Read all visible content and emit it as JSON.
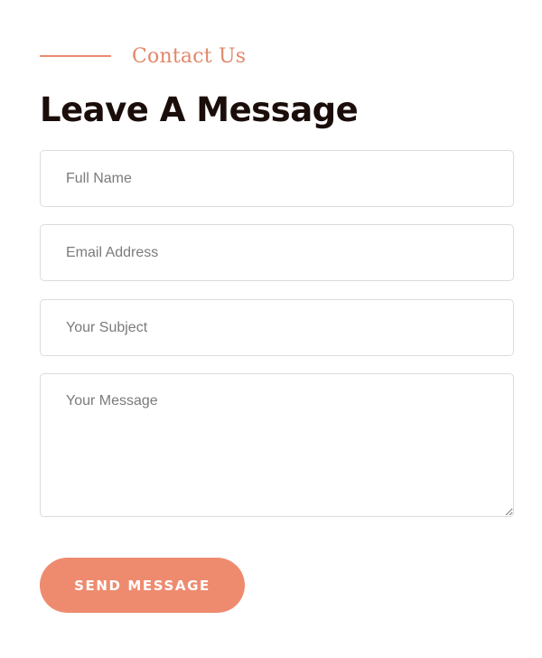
{
  "form": {
    "eyebrow": "Contact Us",
    "title": "Leave A Message",
    "fields": [
      {
        "placeholder": "Full Name",
        "value": ""
      },
      {
        "placeholder": "Email Address",
        "value": ""
      },
      {
        "placeholder": "Your Subject",
        "value": ""
      },
      {
        "placeholder": "Your Message",
        "value": ""
      }
    ],
    "submit_label": "SEND MESSAGE"
  },
  "colors": {
    "accent": "#ee8b6f",
    "heading": "#1b0e0a",
    "border": "#dcdcdc"
  }
}
